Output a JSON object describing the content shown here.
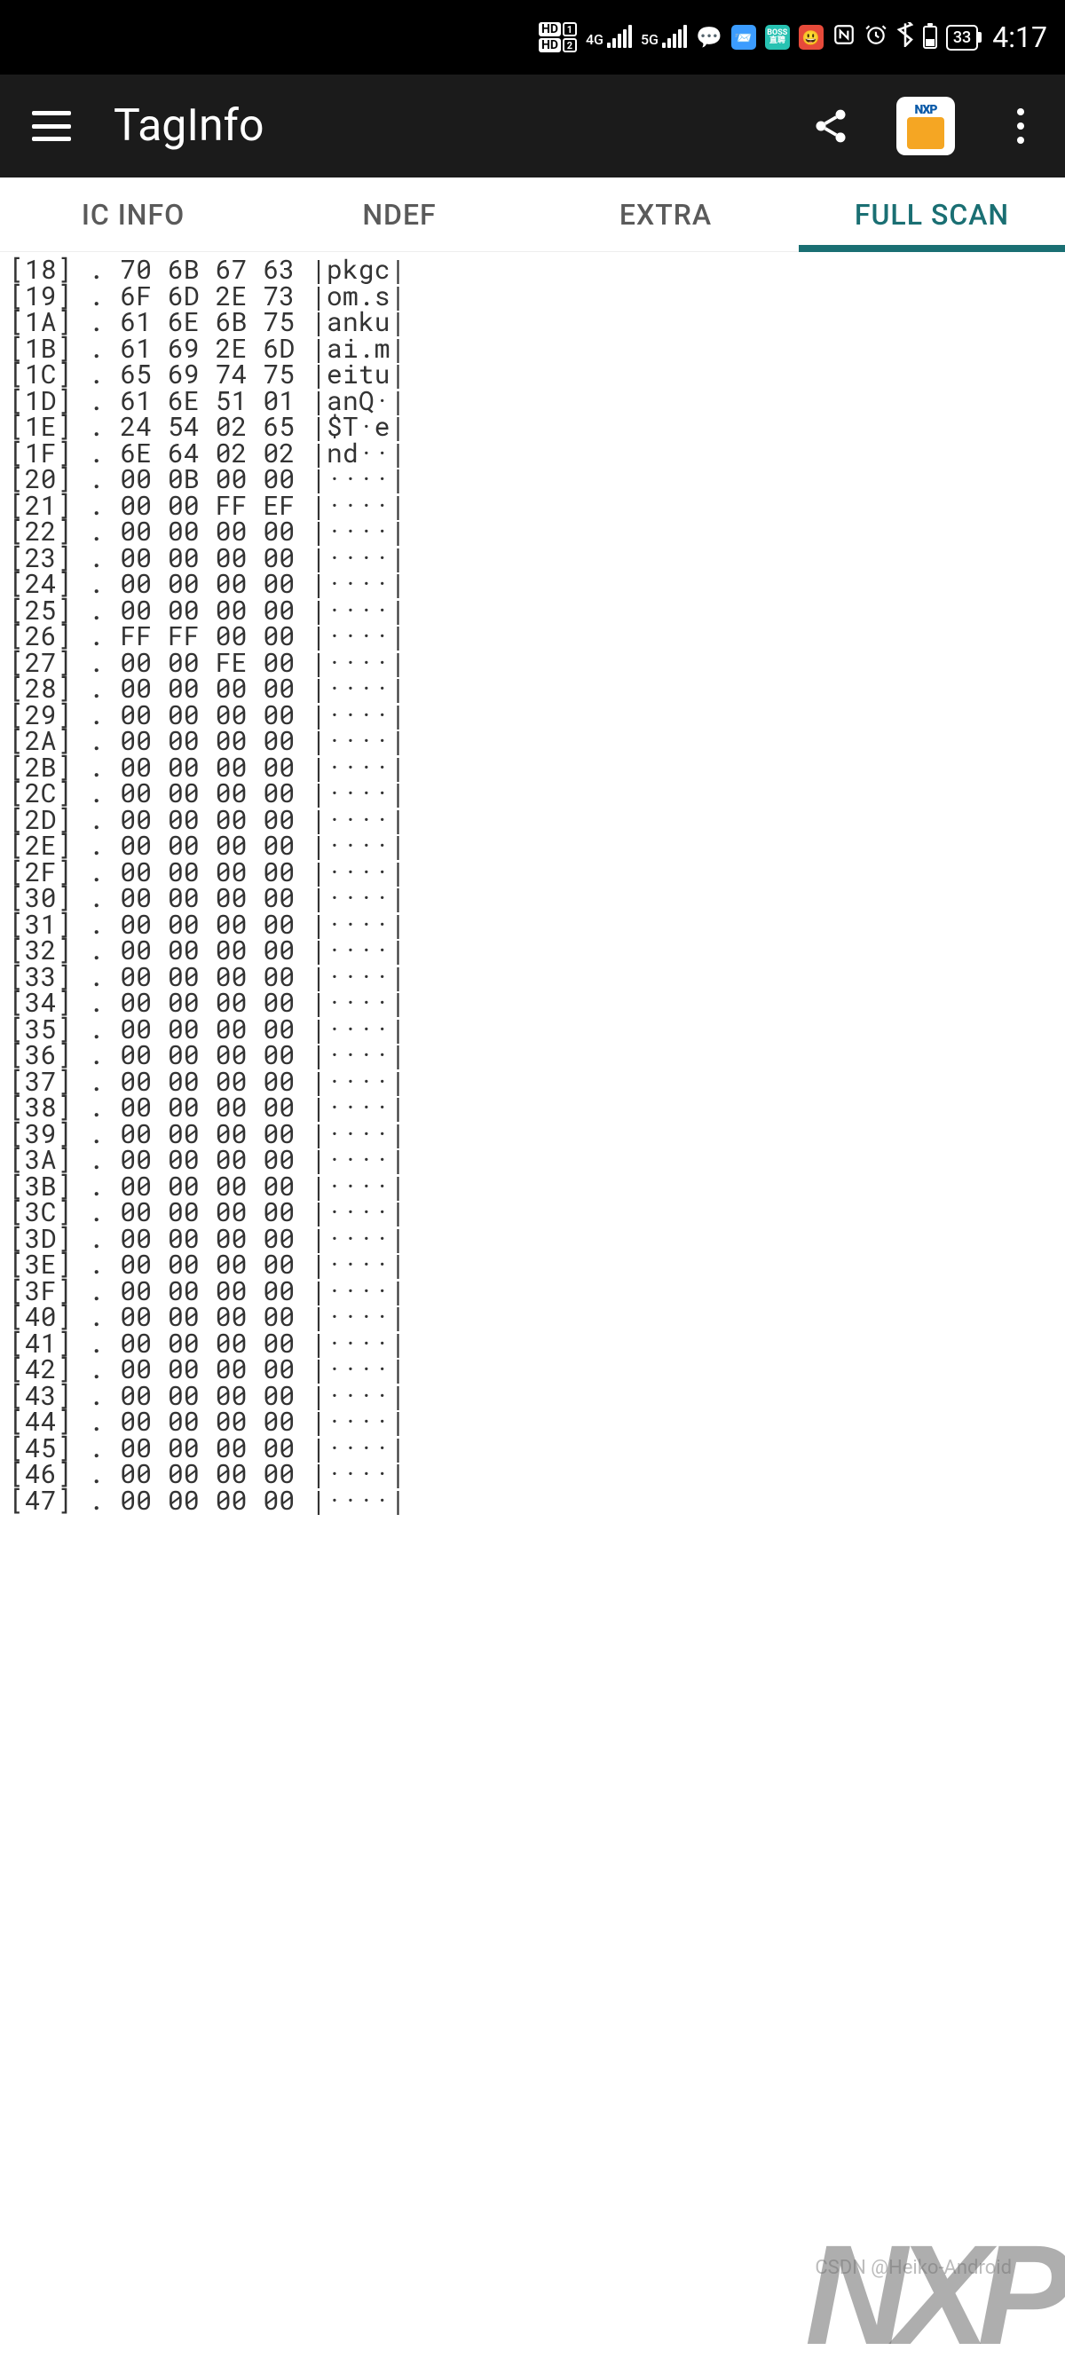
{
  "status": {
    "hd1": "HD",
    "hd2": "HD",
    "sig1_label": "4G",
    "sig2_label": "5G",
    "boss_text": "BOSS",
    "battery_pct": "33",
    "time": "4:17"
  },
  "appbar": {
    "title": "TagInfo"
  },
  "tabs": [
    {
      "label": "IC INFO",
      "active": false
    },
    {
      "label": "NDEF",
      "active": false
    },
    {
      "label": "EXTRA",
      "active": false
    },
    {
      "label": "FULL SCAN",
      "active": true
    }
  ],
  "dump_rows": [
    {
      "addr": "[18]",
      "sep": ".",
      "hex": "70 6B 67 63",
      "ascii": "|pkgc|"
    },
    {
      "addr": "[19]",
      "sep": ".",
      "hex": "6F 6D 2E 73",
      "ascii": "|om.s|"
    },
    {
      "addr": "[1A]",
      "sep": ".",
      "hex": "61 6E 6B 75",
      "ascii": "|anku|"
    },
    {
      "addr": "[1B]",
      "sep": ".",
      "hex": "61 69 2E 6D",
      "ascii": "|ai.m|"
    },
    {
      "addr": "[1C]",
      "sep": ".",
      "hex": "65 69 74 75",
      "ascii": "|eitu|"
    },
    {
      "addr": "[1D]",
      "sep": ".",
      "hex": "61 6E 51 01",
      "ascii": "|anQ·|"
    },
    {
      "addr": "[1E]",
      "sep": ".",
      "hex": "24 54 02 65",
      "ascii": "|$T·e|"
    },
    {
      "addr": "[1F]",
      "sep": ".",
      "hex": "6E 64 02 02",
      "ascii": "|nd··|"
    },
    {
      "addr": "[20]",
      "sep": ".",
      "hex": "00 0B 00 00",
      "ascii": "|····|"
    },
    {
      "addr": "[21]",
      "sep": ".",
      "hex": "00 00 FF EF",
      "ascii": "|····|"
    },
    {
      "addr": "[22]",
      "sep": ".",
      "hex": "00 00 00 00",
      "ascii": "|····|"
    },
    {
      "addr": "[23]",
      "sep": ".",
      "hex": "00 00 00 00",
      "ascii": "|····|"
    },
    {
      "addr": "[24]",
      "sep": ".",
      "hex": "00 00 00 00",
      "ascii": "|····|"
    },
    {
      "addr": "[25]",
      "sep": ".",
      "hex": "00 00 00 00",
      "ascii": "|····|"
    },
    {
      "addr": "[26]",
      "sep": ".",
      "hex": "FF FF 00 00",
      "ascii": "|····|"
    },
    {
      "addr": "[27]",
      "sep": ".",
      "hex": "00 00 FE 00",
      "ascii": "|····|"
    },
    {
      "addr": "[28]",
      "sep": ".",
      "hex": "00 00 00 00",
      "ascii": "|····|"
    },
    {
      "addr": "[29]",
      "sep": ".",
      "hex": "00 00 00 00",
      "ascii": "|····|"
    },
    {
      "addr": "[2A]",
      "sep": ".",
      "hex": "00 00 00 00",
      "ascii": "|····|"
    },
    {
      "addr": "[2B]",
      "sep": ".",
      "hex": "00 00 00 00",
      "ascii": "|····|"
    },
    {
      "addr": "[2C]",
      "sep": ".",
      "hex": "00 00 00 00",
      "ascii": "|····|"
    },
    {
      "addr": "[2D]",
      "sep": ".",
      "hex": "00 00 00 00",
      "ascii": "|····|"
    },
    {
      "addr": "[2E]",
      "sep": ".",
      "hex": "00 00 00 00",
      "ascii": "|····|"
    },
    {
      "addr": "[2F]",
      "sep": ".",
      "hex": "00 00 00 00",
      "ascii": "|····|"
    },
    {
      "addr": "[30]",
      "sep": ".",
      "hex": "00 00 00 00",
      "ascii": "|····|"
    },
    {
      "addr": "[31]",
      "sep": ".",
      "hex": "00 00 00 00",
      "ascii": "|····|"
    },
    {
      "addr": "[32]",
      "sep": ".",
      "hex": "00 00 00 00",
      "ascii": "|····|"
    },
    {
      "addr": "[33]",
      "sep": ".",
      "hex": "00 00 00 00",
      "ascii": "|····|"
    },
    {
      "addr": "[34]",
      "sep": ".",
      "hex": "00 00 00 00",
      "ascii": "|····|"
    },
    {
      "addr": "[35]",
      "sep": ".",
      "hex": "00 00 00 00",
      "ascii": "|····|"
    },
    {
      "addr": "[36]",
      "sep": ".",
      "hex": "00 00 00 00",
      "ascii": "|····|"
    },
    {
      "addr": "[37]",
      "sep": ".",
      "hex": "00 00 00 00",
      "ascii": "|····|"
    },
    {
      "addr": "[38]",
      "sep": ".",
      "hex": "00 00 00 00",
      "ascii": "|····|"
    },
    {
      "addr": "[39]",
      "sep": ".",
      "hex": "00 00 00 00",
      "ascii": "|····|"
    },
    {
      "addr": "[3A]",
      "sep": ".",
      "hex": "00 00 00 00",
      "ascii": "|····|"
    },
    {
      "addr": "[3B]",
      "sep": ".",
      "hex": "00 00 00 00",
      "ascii": "|····|"
    },
    {
      "addr": "[3C]",
      "sep": ".",
      "hex": "00 00 00 00",
      "ascii": "|····|"
    },
    {
      "addr": "[3D]",
      "sep": ".",
      "hex": "00 00 00 00",
      "ascii": "|····|"
    },
    {
      "addr": "[3E]",
      "sep": ".",
      "hex": "00 00 00 00",
      "ascii": "|····|"
    },
    {
      "addr": "[3F]",
      "sep": ".",
      "hex": "00 00 00 00",
      "ascii": "|····|"
    },
    {
      "addr": "[40]",
      "sep": ".",
      "hex": "00 00 00 00",
      "ascii": "|····|"
    },
    {
      "addr": "[41]",
      "sep": ".",
      "hex": "00 00 00 00",
      "ascii": "|····|"
    },
    {
      "addr": "[42]",
      "sep": ".",
      "hex": "00 00 00 00",
      "ascii": "|····|"
    },
    {
      "addr": "[43]",
      "sep": ".",
      "hex": "00 00 00 00",
      "ascii": "|····|"
    },
    {
      "addr": "[44]",
      "sep": ".",
      "hex": "00 00 00 00",
      "ascii": "|····|"
    },
    {
      "addr": "[45]",
      "sep": ".",
      "hex": "00 00 00 00",
      "ascii": "|····|"
    },
    {
      "addr": "[46]",
      "sep": ".",
      "hex": "00 00 00 00",
      "ascii": "|····|"
    },
    {
      "addr": "[47]",
      "sep": ".",
      "hex": "00 00 00 00",
      "ascii": "|····|"
    }
  ],
  "watermark": {
    "nxp": "NXP",
    "csdn": "CSDN @Heiko-Android"
  }
}
